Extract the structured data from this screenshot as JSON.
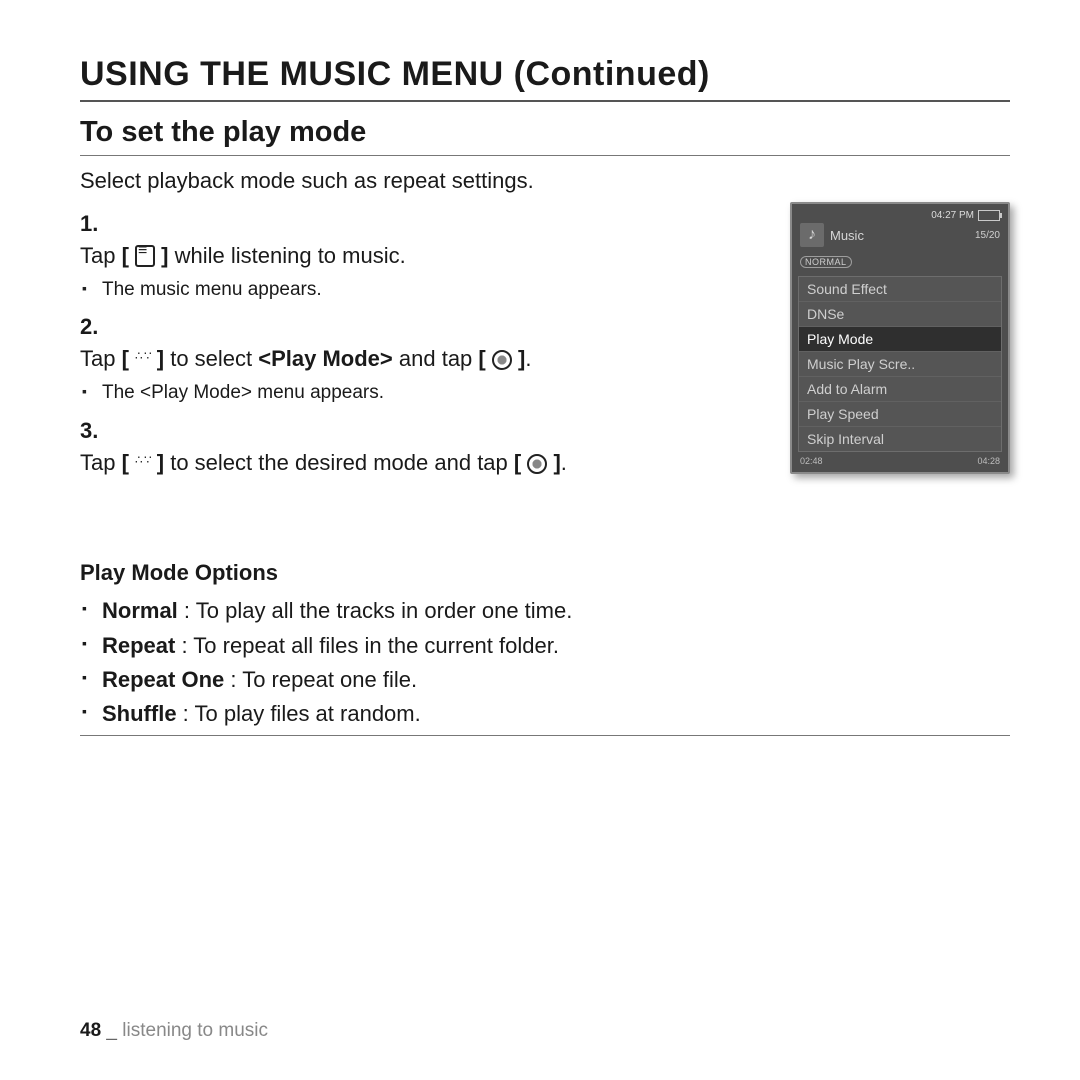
{
  "page": {
    "title": "USING THE MUSIC MENU (Continued)",
    "section_title": "To set the play mode",
    "intro": "Select playback mode such as repeat settings."
  },
  "steps": [
    {
      "num": "1.",
      "pre": "Tap ",
      "icon_hint": "menu",
      "post": " while listening to music.",
      "sub": "The music menu appears."
    },
    {
      "num": "2.",
      "pre": "Tap ",
      "icon_hint": "updown",
      "mid": " to select ",
      "bold": "<Play Mode>",
      "mid2": " and tap ",
      "icon2_hint": "ok",
      "post": ".",
      "sub": "The <Play Mode> menu appears."
    },
    {
      "num": "3.",
      "pre": "Tap ",
      "icon_hint": "updown",
      "mid": " to select the desired mode and tap ",
      "icon2_hint": "ok",
      "post": "."
    }
  ],
  "options_title": "Play Mode Options",
  "options": [
    {
      "name": "Normal",
      "desc": " : To play all the tracks in order one time."
    },
    {
      "name": "Repeat",
      "desc": " : To repeat all files in the current folder."
    },
    {
      "name": "Repeat One",
      "desc": " : To repeat one file."
    },
    {
      "name": "Shuffle",
      "desc": " : To play files at random."
    }
  ],
  "device": {
    "clock": "04:27 PM",
    "header_title": "Music",
    "track_count": "15/20",
    "badge": "NORMAL",
    "menu": [
      {
        "label": "Sound Effect",
        "selected": false
      },
      {
        "label": "DNSe",
        "selected": false
      },
      {
        "label": "Play Mode",
        "selected": true
      },
      {
        "label": "Music Play Scre..",
        "selected": false
      },
      {
        "label": "Add to Alarm",
        "selected": false
      },
      {
        "label": "Play Speed",
        "selected": false
      },
      {
        "label": "Skip Interval",
        "selected": false
      }
    ],
    "time_left": "02:48",
    "time_right": "04:28"
  },
  "footer": {
    "page_num": "48",
    "separator": "_",
    "chapter": "listening to music"
  }
}
